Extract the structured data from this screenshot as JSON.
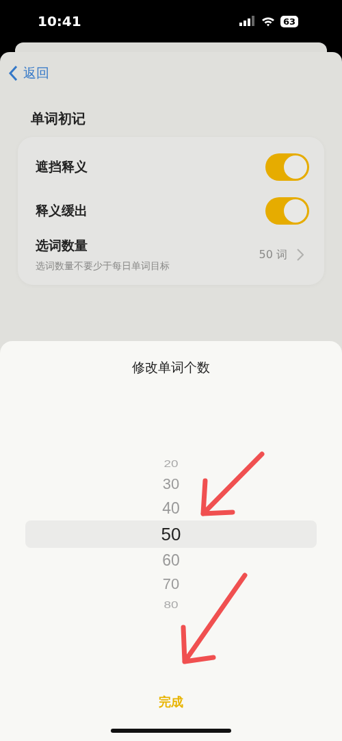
{
  "status_bar": {
    "time": "10:41",
    "battery": "63"
  },
  "nav": {
    "back": "返回"
  },
  "sections": [
    {
      "title": "单词初记",
      "rows": [
        {
          "kind": "toggle",
          "label": "遮挡释义",
          "on": true
        },
        {
          "kind": "toggle",
          "label": "释义缓出",
          "on": true
        },
        {
          "kind": "link",
          "label": "选词数量",
          "subtitle": "选词数量不要少于每日单词目标",
          "value": "50 词"
        }
      ]
    }
  ],
  "sheet": {
    "title": "修改单词个数",
    "picker": [
      {
        "label": "20",
        "selected": false
      },
      {
        "label": "30",
        "selected": false
      },
      {
        "label": "40",
        "selected": false
      },
      {
        "label": "50",
        "selected": true
      },
      {
        "label": "60",
        "selected": false
      },
      {
        "label": "70",
        "selected": false
      },
      {
        "label": "80",
        "selected": false
      }
    ],
    "done": "完成"
  }
}
